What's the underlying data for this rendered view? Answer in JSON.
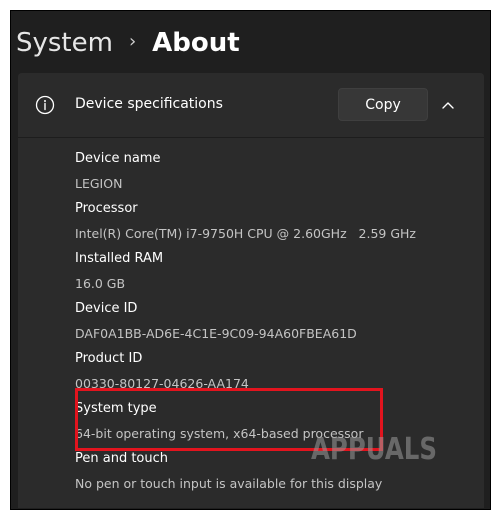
{
  "breadcrumb": {
    "parent": "System",
    "separator": "›",
    "current": "About"
  },
  "card": {
    "title": "Device specifications",
    "copy_label": "Copy",
    "specs": [
      {
        "label": "Device name",
        "value": "LEGION"
      },
      {
        "label": "Processor",
        "value": "Intel(R) Core(TM) i7-9750H CPU @ 2.60GHz   2.59 GHz"
      },
      {
        "label": "Installed RAM",
        "value": "16.0 GB"
      },
      {
        "label": "Device ID",
        "value": "DAF0A1BB-AD6E-4C1E-9C09-94A60FBEA61D"
      },
      {
        "label": "Product ID",
        "value": "00330-80127-04626-AA174"
      },
      {
        "label": "System type",
        "value": "64-bit operating system, x64-based processor"
      },
      {
        "label": "Pen and touch",
        "value": "No pen or touch input is available for this display"
      }
    ]
  },
  "watermark": {
    "text": "APPUALS"
  },
  "icons": {
    "info": "info-circle-icon",
    "chevron": "chevron-up-icon"
  },
  "colors": {
    "background": "#1f1f1f",
    "card": "#2b2b2b",
    "highlight": "#e2141e"
  }
}
